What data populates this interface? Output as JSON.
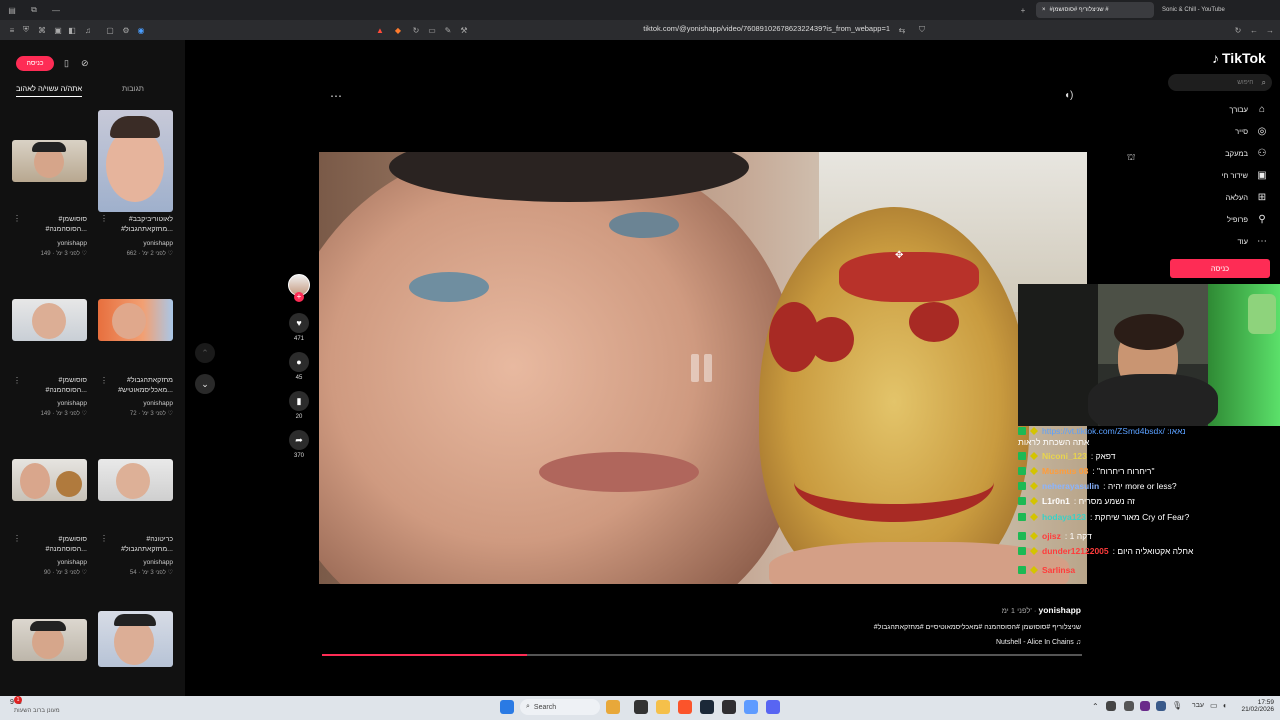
{
  "browser": {
    "tabs": [
      {
        "title": "#שניצלוריף #סוסושמן #",
        "active": true
      },
      {
        "title": "Sonic & Chill - YouTube",
        "active": false
      }
    ],
    "url": "tiktok.com/@yonishapp/video/7608910267862322439?is_from_webapp=1"
  },
  "left": {
    "login_label": "כניסה",
    "tabs": [
      {
        "label": "אתה/ה עשוי/ה לאהוב",
        "active": true
      },
      {
        "label": "תגובות",
        "active": false
      }
    ],
    "videos": [
      {
        "title1": "#לאוטוריביקבב",
        "title2": "#מחזקאתהגבול...",
        "user": "yonishapp",
        "likes": "662",
        "time": "לפני 2 ימ'"
      },
      {
        "title1": "#סוסושמן",
        "title2": "#הסוסהמנה...",
        "user": "yonishapp",
        "likes": "149",
        "time": "לפני 3 ימ'"
      },
      {
        "title1": "#מחזקאתהגבול",
        "title2": "#מאכליסמאוטיש...",
        "user": "yonishapp",
        "likes": "72",
        "time": "לפני 3 ימ'"
      },
      {
        "title1": "#סוסושמן",
        "title2": "#הסוסהמנה...",
        "user": "yonishapp",
        "likes": "149",
        "time": "לפני 3 ימ'"
      },
      {
        "title1": "#כריטונה",
        "title2": "#מחזקאתהגבול...",
        "user": "yonishapp",
        "likes": "54",
        "time": "לפני 3 ימ'"
      },
      {
        "title1": "#סוסושמן",
        "title2": "#הסוסהמנה...",
        "user": "yonishapp",
        "likes": "90",
        "time": "לפני 3 ימ'"
      }
    ]
  },
  "player": {
    "likes": "471",
    "comments": "45",
    "saves": "20",
    "shares": "370",
    "username": "yonishapp",
    "posted": "לפני 1 ימ'",
    "caption": "#שניצלוריף #סוסושמן #הסוסהמנה #מאכליסמאוטיסיים #מחזקאתהגבול",
    "music": "Nutshell - Alice In Chains",
    "progress": 0.27
  },
  "nav": {
    "logo": "TikTok",
    "search_placeholder": "חיפוש",
    "items": [
      {
        "label": "עבורך",
        "icon": "home-icon"
      },
      {
        "label": "סייר",
        "icon": "compass-icon"
      },
      {
        "label": "במעקב",
        "icon": "following-icon"
      },
      {
        "label": "שידור חי",
        "icon": "live-icon"
      },
      {
        "label": "העלאה",
        "icon": "upload-icon"
      },
      {
        "label": "פרופיל",
        "icon": "profile-icon"
      },
      {
        "label": "עוד",
        "icon": "more-icon"
      }
    ],
    "login_label": "כניסה"
  },
  "chat": {
    "lines": [
      {
        "user": "",
        "text": "https://vt.tiktok.com/ZSmd4bsdx/ :נאאו",
        "color": "#5aa0ff"
      },
      {
        "user": "",
        "text": "אתה השכחת לראות",
        "color": "#fff"
      },
      {
        "user": "Niconi_123",
        "text": ": דפאק",
        "color": "#e8d44d"
      },
      {
        "user": "Musmus 08",
        "text": ": \"ריחרוח ריחרוח\"",
        "color": "#ff9d3b"
      },
      {
        "user": "neherayasulin",
        "text": ": יהיה more or less?",
        "color": "#8ab4ff"
      },
      {
        "user": "L1r0n1",
        "text": ": זה נשמע מסריח",
        "color": "#ffffff"
      },
      {
        "user": "hodaya123",
        "text": ": מאור שיחקת Cry of Fear?",
        "color": "#3ad1c6"
      },
      {
        "user": "ojisz",
        "text": ": דקה 1",
        "color": "#ff3b3b"
      },
      {
        "user": "dunder12122005",
        "text": ": אחלה אקטואליה היום",
        "color": "#ff3b3b"
      },
      {
        "user": "Sarlinsa",
        "text": "",
        "color": "#ff3b3b"
      }
    ]
  },
  "taskbar": {
    "weather_temp": "9°C",
    "weather_desc": "מעונן ברוב השעות",
    "search_placeholder": "Search",
    "time": "17:59",
    "date": "21/02/2026",
    "lang": "עבר"
  }
}
